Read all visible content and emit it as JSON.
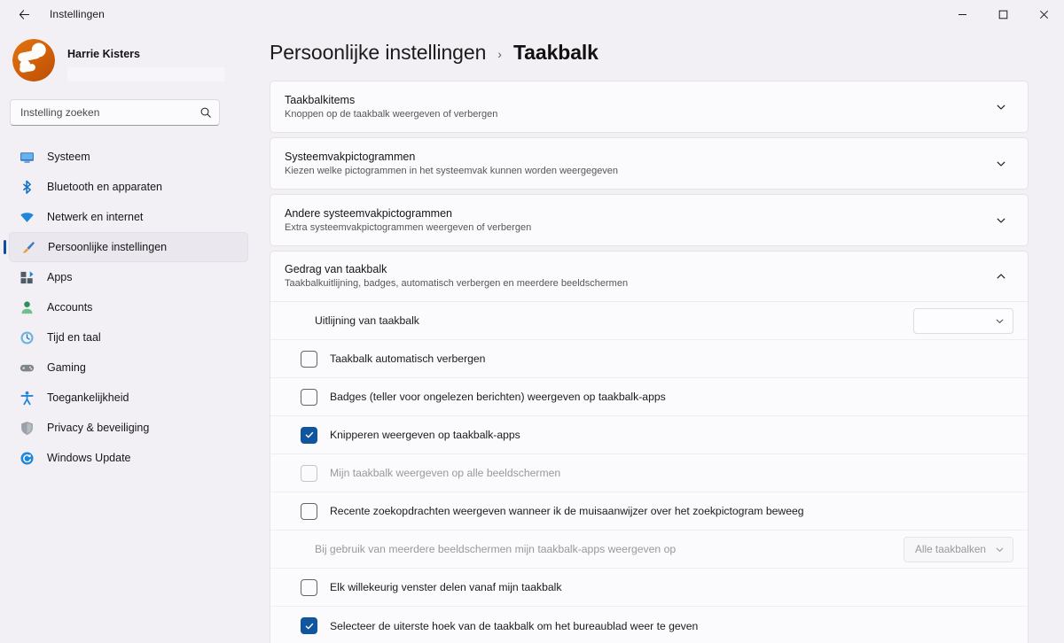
{
  "window": {
    "title": "Instellingen",
    "back_label": "back-arrow",
    "controls": {
      "minimize": "–",
      "maximize": "□",
      "close": "×"
    }
  },
  "sidebar": {
    "profile": {
      "name": "Harrie Kisters"
    },
    "search": {
      "placeholder": "Instelling zoeken",
      "value": ""
    },
    "items": [
      {
        "label": "Systeem",
        "icon": "monitor-icon",
        "selected": false
      },
      {
        "label": "Bluetooth en apparaten",
        "icon": "bluetooth-icon",
        "selected": false
      },
      {
        "label": "Netwerk en internet",
        "icon": "wifi-icon",
        "selected": false
      },
      {
        "label": "Persoonlijke instellingen",
        "icon": "brush-icon",
        "selected": true
      },
      {
        "label": "Apps",
        "icon": "apps-icon",
        "selected": false
      },
      {
        "label": "Accounts",
        "icon": "person-icon",
        "selected": false
      },
      {
        "label": "Tijd en taal",
        "icon": "clock-globe-icon",
        "selected": false
      },
      {
        "label": "Gaming",
        "icon": "gamepad-icon",
        "selected": false
      },
      {
        "label": "Toegankelijkheid",
        "icon": "accessibility-icon",
        "selected": false
      },
      {
        "label": "Privacy & beveiliging",
        "icon": "shield-icon",
        "selected": false
      },
      {
        "label": "Windows Update",
        "icon": "update-icon",
        "selected": false
      }
    ]
  },
  "breadcrumb": {
    "parent": "Persoonlijke instellingen",
    "separator": "›",
    "current": "Taakbalk"
  },
  "cards": [
    {
      "title": "Taakbalkitems",
      "subtitle": "Knoppen op de taakbalk weergeven of verbergen",
      "expanded": false,
      "chevron": "chevron-down-icon"
    },
    {
      "title": "Systeemvakpictogrammen",
      "subtitle": "Kiezen welke pictogrammen in het systeemvak kunnen worden weergegeven",
      "expanded": false,
      "chevron": "chevron-down-icon"
    },
    {
      "title": "Andere systeemvakpictogrammen",
      "subtitle": "Extra systeemvakpictogrammen weergeven of verbergen",
      "expanded": false,
      "chevron": "chevron-down-icon"
    }
  ],
  "expanded_card": {
    "title": "Gedrag van taakbalk",
    "subtitle": "Taakbalkuitlijning, badges, automatisch verbergen en meerdere beeldschermen",
    "chevron": "chevron-up-icon",
    "rows": [
      {
        "type": "dropdown",
        "label": "Uitlijning van taakbalk",
        "value": "",
        "disabled": false
      },
      {
        "type": "checkbox",
        "label": "Taakbalk automatisch verbergen",
        "checked": false,
        "disabled": false
      },
      {
        "type": "checkbox",
        "label": "Badges (teller voor ongelezen berichten) weergeven op taakbalk-apps",
        "checked": false,
        "disabled": false
      },
      {
        "type": "checkbox",
        "label": "Knipperen weergeven op taakbalk-apps",
        "checked": true,
        "disabled": false
      },
      {
        "type": "checkbox",
        "label": "Mijn taakbalk weergeven op alle beeldschermen",
        "checked": false,
        "disabled": true
      },
      {
        "type": "checkbox",
        "label": "Recente zoekopdrachten weergeven wanneer ik de muisaanwijzer over het zoekpictogram beweeg",
        "checked": false,
        "disabled": false
      },
      {
        "type": "dropdown",
        "label": "Bij gebruik van meerdere beeldschermen mijn taakbalk-apps weergeven op",
        "value": "Alle taakbalken",
        "disabled": true
      },
      {
        "type": "checkbox",
        "label": "Elk willekeurig venster delen vanaf mijn taakbalk",
        "checked": false,
        "disabled": false
      },
      {
        "type": "checkbox",
        "label": "Selecteer de uiterste hoek van de taakbalk om het bureaublad weer te geven",
        "checked": true,
        "disabled": false
      }
    ]
  },
  "colors": {
    "accent": "#11559e",
    "selection_bar": "#0f4f9e",
    "window_bg": "#f3f0f5",
    "card_bg": "#fbfafc",
    "avatar_orange": "#cf5f09"
  }
}
